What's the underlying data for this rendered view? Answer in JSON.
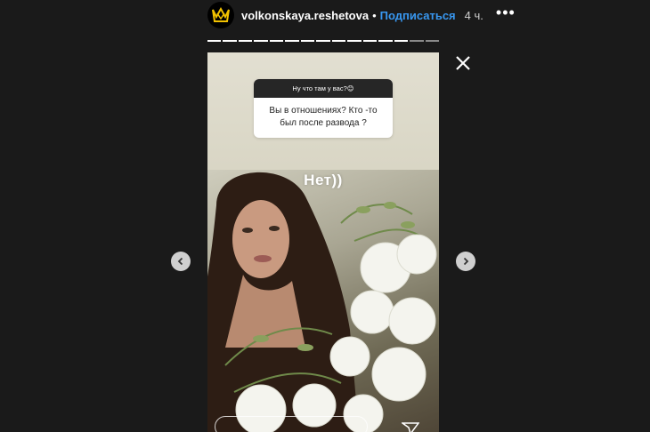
{
  "header": {
    "username": "volkonskaya.reshetova",
    "separator": "•",
    "follow_label": "Подписаться",
    "time": "4 ч.",
    "more": "•••"
  },
  "story": {
    "question_prompt": "Ну что там у вас?😊",
    "question_text": "Вы в отношениях? Кто -то был после развода ?",
    "answer_text": "Нет))",
    "progress_segments_total": 15,
    "progress_current_segment": 13
  },
  "colors": {
    "background": "#1a1a1a",
    "follow": "#3897f0",
    "question_header": "#262626"
  },
  "icons": {
    "close": "close-icon",
    "prev": "chevron-left-icon",
    "next": "chevron-right-icon",
    "send": "send-icon",
    "avatar_logo": "crown-logo"
  }
}
